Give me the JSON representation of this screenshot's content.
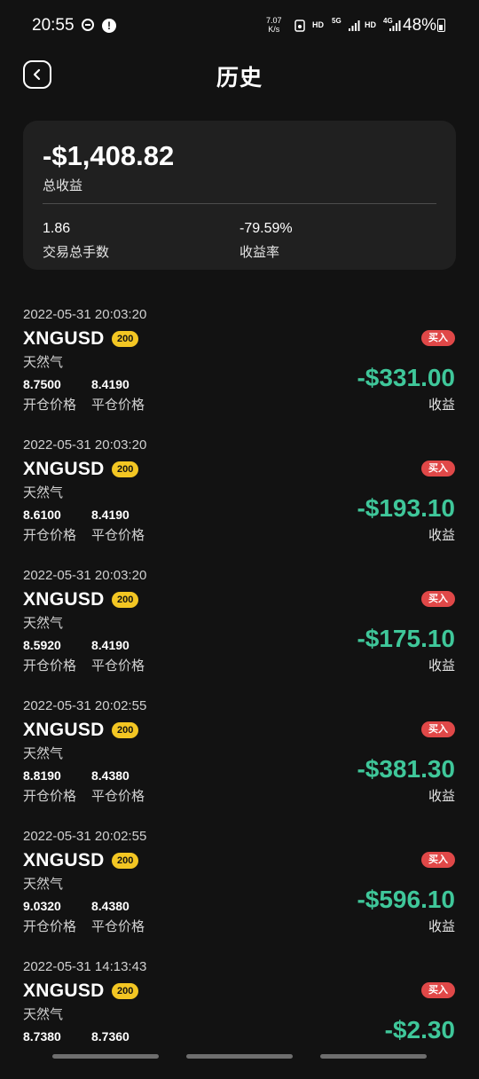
{
  "status_bar": {
    "time": "20:55",
    "net_speed_value": "7.07",
    "net_speed_unit": "K/s",
    "hd1": "HD",
    "net_5g": "5G",
    "hd2": "HD",
    "net_4g": "4G",
    "battery": "48%"
  },
  "header": {
    "title": "历史"
  },
  "summary": {
    "total_pnl": "-$1,408.82",
    "total_pnl_label": "总收益",
    "lots": "1.86",
    "lots_label": "交易总手数",
    "return_rate": "-79.59%",
    "return_rate_label": "收益率"
  },
  "labels": {
    "open_price": "开仓价格",
    "close_price": "平仓价格",
    "pnl": "收益"
  },
  "trades": [
    {
      "datetime": "2022-05-31 20:03:20",
      "symbol": "XNGUSD",
      "leverage": "200",
      "name": "天然气",
      "side": "买入",
      "open_price": "8.7500",
      "close_price": "8.4190",
      "pnl": "-$331.00"
    },
    {
      "datetime": "2022-05-31 20:03:20",
      "symbol": "XNGUSD",
      "leverage": "200",
      "name": "天然气",
      "side": "买入",
      "open_price": "8.6100",
      "close_price": "8.4190",
      "pnl": "-$193.10"
    },
    {
      "datetime": "2022-05-31 20:03:20",
      "symbol": "XNGUSD",
      "leverage": "200",
      "name": "天然气",
      "side": "买入",
      "open_price": "8.5920",
      "close_price": "8.4190",
      "pnl": "-$175.10"
    },
    {
      "datetime": "2022-05-31 20:02:55",
      "symbol": "XNGUSD",
      "leverage": "200",
      "name": "天然气",
      "side": "买入",
      "open_price": "8.8190",
      "close_price": "8.4380",
      "pnl": "-$381.30"
    },
    {
      "datetime": "2022-05-31 20:02:55",
      "symbol": "XNGUSD",
      "leverage": "200",
      "name": "天然气",
      "side": "买入",
      "open_price": "9.0320",
      "close_price": "8.4380",
      "pnl": "-$596.10"
    },
    {
      "datetime": "2022-05-31 14:13:43",
      "symbol": "XNGUSD",
      "leverage": "200",
      "name": "天然气",
      "side": "买入",
      "open_price": "8.7380",
      "close_price": "8.7360",
      "pnl": "-$2.30"
    }
  ],
  "colors": {
    "background": "#121212",
    "card": "#202020",
    "pnl": "#3fc79a",
    "side_badge": "#e04848",
    "leverage_badge": "#f3c623"
  }
}
